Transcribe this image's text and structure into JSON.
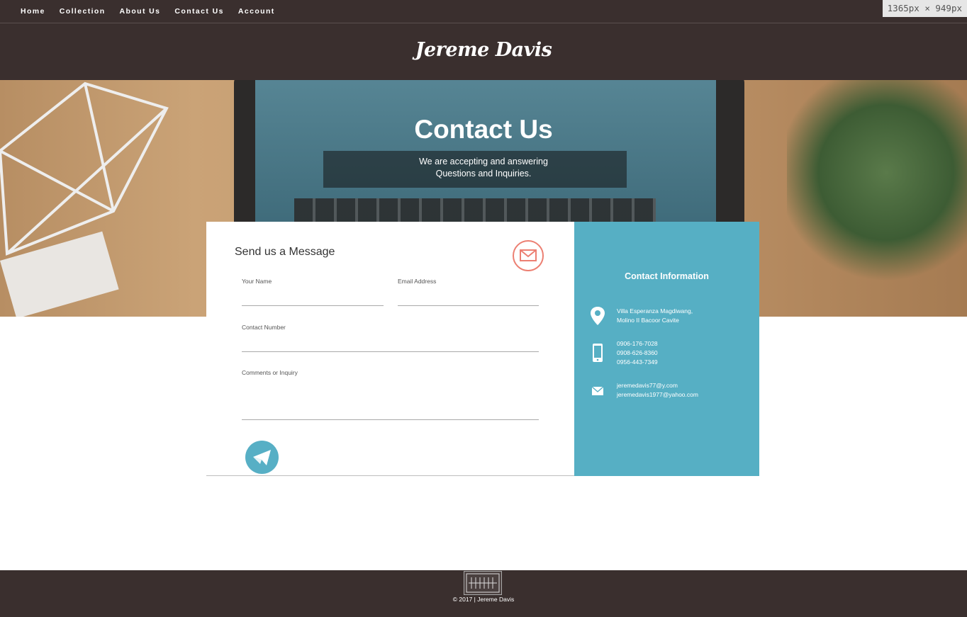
{
  "nav": {
    "items": [
      {
        "label": "Home"
      },
      {
        "label": "Collection"
      },
      {
        "label": "About Us"
      },
      {
        "label": "Contact Us"
      },
      {
        "label": "Account"
      }
    ]
  },
  "viewport_badge": "1365px × 949px",
  "brand": {
    "name": "Jereme Davis"
  },
  "hero": {
    "title": "Contact Us",
    "subtitle_line1": "We are accepting and answering",
    "subtitle_line2": "Questions and Inquiries."
  },
  "form": {
    "heading": "Send us a Message",
    "name_label": "Your Name",
    "email_label": "Email Address",
    "contact_label": "Contact Number",
    "comments_label": "Comments or Inquiry",
    "mail_icon": "envelope-icon",
    "send_icon": "paper-plane-icon"
  },
  "info": {
    "heading": "Contact Information",
    "address_line1": "Villa Esperanza Magdiwang,",
    "address_line2": "Molino II Bacoor Cavite",
    "phones": [
      "0906-176-7028",
      "0908-626-8360",
      "0956-443-7349"
    ],
    "emails": [
      "jeremedavis77@y.com",
      "jeremedavis1977@yahoo.com"
    ],
    "icons": {
      "address": "map-pin-icon",
      "phone": "mobile-phone-icon",
      "email": "envelope-icon"
    }
  },
  "footer": {
    "copyright": "© 2017 | Jereme Davis"
  },
  "colors": {
    "dark": "#3a2f2e",
    "accent": "#56afc4",
    "mail": "#ec7f72"
  }
}
